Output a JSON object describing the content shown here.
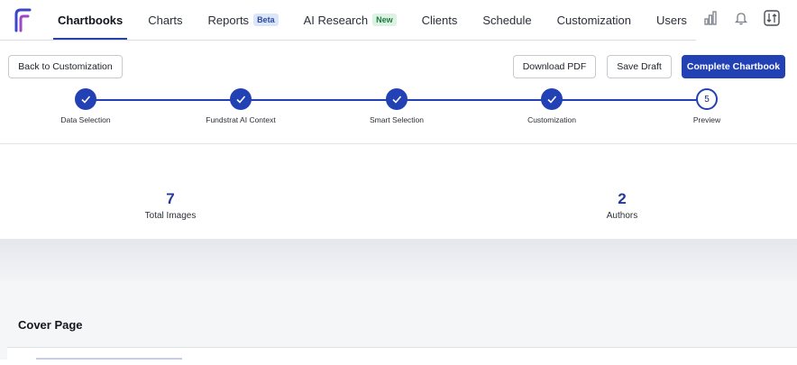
{
  "nav": {
    "tabs": [
      {
        "label": "Chartbooks",
        "active": true
      },
      {
        "label": "Charts"
      },
      {
        "label": "Reports",
        "badge": "Beta"
      },
      {
        "label": "AI Research",
        "badge": "New"
      },
      {
        "label": "Clients"
      },
      {
        "label": "Schedule"
      },
      {
        "label": "Customization"
      },
      {
        "label": "Users"
      }
    ],
    "icons": [
      "bar-chart-icon",
      "bell-icon",
      "sort-settings-icon"
    ]
  },
  "actions": {
    "back_label": "Back to Customization",
    "download_label": "Download PDF",
    "save_label": "Save Draft",
    "complete_label": "Complete Chartbook"
  },
  "stepper": {
    "steps": [
      {
        "label": "Data Selection",
        "state": "done"
      },
      {
        "label": "Fundstrat AI Context",
        "state": "done"
      },
      {
        "label": "Smart Selection",
        "state": "done"
      },
      {
        "label": "Customization",
        "state": "done"
      },
      {
        "label": "Preview",
        "state": "current",
        "number": "5"
      }
    ]
  },
  "stats": [
    {
      "value": "7",
      "label": "Total Images"
    },
    {
      "value": "2",
      "label": "Authors"
    }
  ],
  "section": {
    "title": "Cover Page"
  },
  "colors": {
    "accent": "#2241b5",
    "stat_value": "#23389b"
  }
}
